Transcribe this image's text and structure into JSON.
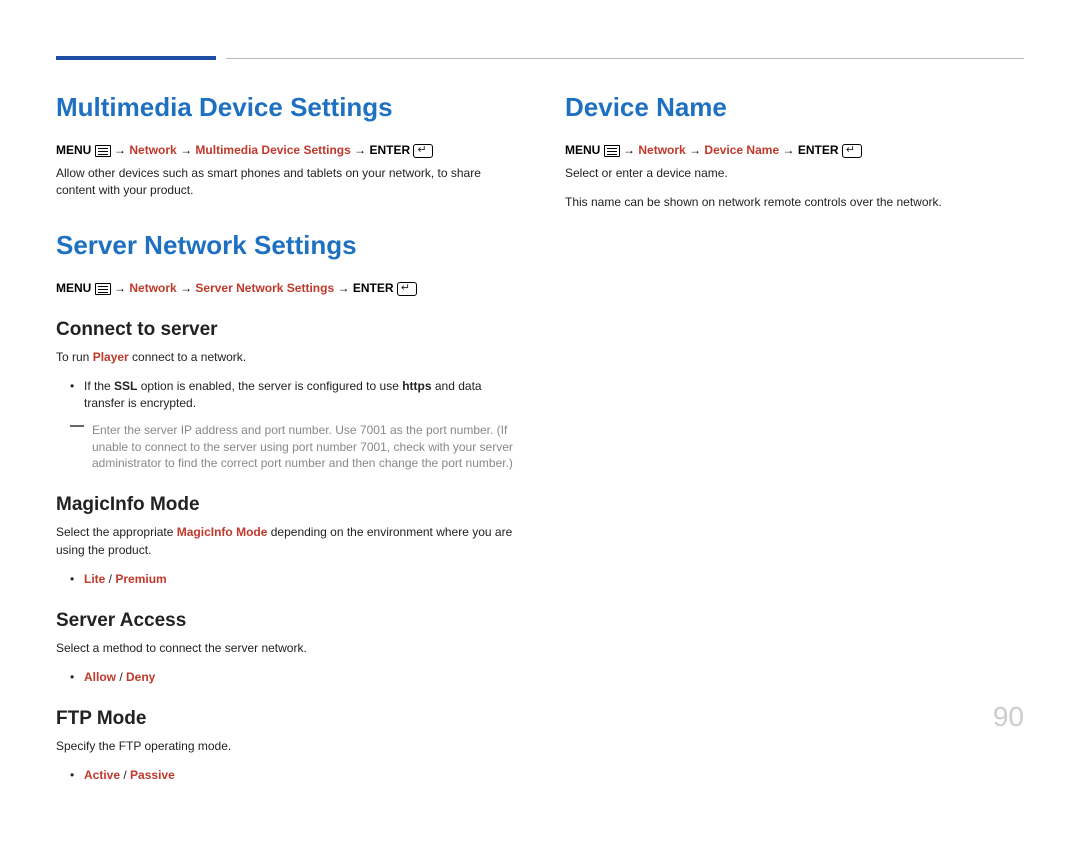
{
  "pagenum": "90",
  "col1": {
    "s1": {
      "h1": "Multimedia Device Settings",
      "menu": "MENU",
      "enter": "ENTER",
      "path1": "Network",
      "path2": "Multimedia Device Settings",
      "desc": "Allow other devices such as smart phones and tablets on your network, to share content with your product."
    },
    "s2": {
      "h1": "Server Network Settings",
      "menu": "MENU",
      "enter": "ENTER",
      "path1": "Network",
      "path2": "Server Network Settings",
      "sub1": {
        "h2": "Connect to server",
        "run_pre": "To run ",
        "run_player": "Player",
        "run_post": " connect to a network.",
        "ssl_pre": "If the ",
        "ssl": "SSL",
        "ssl_mid": " option is enabled, the server is configured to use ",
        "https": "https",
        "ssl_post": " and data transfer is encrypted.",
        "note": "Enter the server IP address and port number. Use 7001 as the port number. (If unable to connect to the server using port number 7001, check with your server administrator to find the correct port number and then change the port number.)"
      },
      "sub2": {
        "h2": "MagicInfo Mode",
        "pre": "Select the appropriate ",
        "mode": "MagicInfo Mode",
        "post": " depending on the environment where you are using the product.",
        "opt1": "Lite",
        "sep": " / ",
        "opt2": "Premium"
      },
      "sub3": {
        "h2": "Server Access",
        "desc": "Select a method to connect the server network.",
        "opt1": "Allow",
        "sep": " / ",
        "opt2": "Deny"
      },
      "sub4": {
        "h2": "FTP Mode",
        "desc": "Specify the FTP operating mode.",
        "opt1": "Active",
        "sep": " / ",
        "opt2": "Passive"
      }
    }
  },
  "col2": {
    "s1": {
      "h1": "Device Name",
      "menu": "MENU",
      "enter": "ENTER",
      "path1": "Network",
      "path2": "Device Name",
      "desc1": "Select or enter a device name.",
      "desc2": "This name can be shown on network remote controls over the network."
    }
  }
}
